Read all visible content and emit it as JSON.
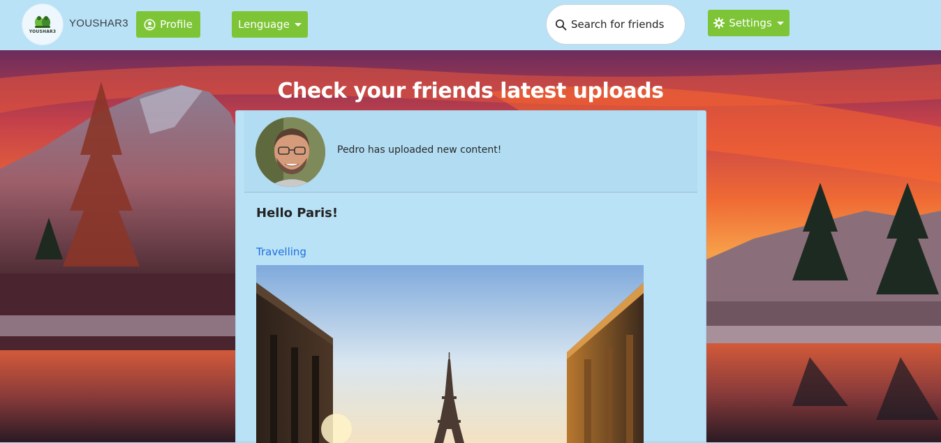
{
  "navbar": {
    "logo_text": "YOUSHAR3",
    "brand": "YOUSHAR3",
    "profile_label": "Profile",
    "language_label": "Lenguage",
    "search_placeholder": "Search for friends",
    "settings_label": "Settings"
  },
  "hero": {
    "heading": "Check your friends latest uploads"
  },
  "post": {
    "message": "Pedro has uploaded new content!",
    "title": "Hello Paris!",
    "category": "Travelling"
  },
  "colors": {
    "navbar_bg": "#b9e2f7",
    "button_green": "#7dc536",
    "link_blue": "#1f6fe0",
    "card_bg": "#b9e2f7"
  },
  "icons": {
    "profile": "user-circle-icon",
    "search": "search-icon",
    "settings": "gear-icon",
    "dropdown": "caret-down-icon"
  }
}
